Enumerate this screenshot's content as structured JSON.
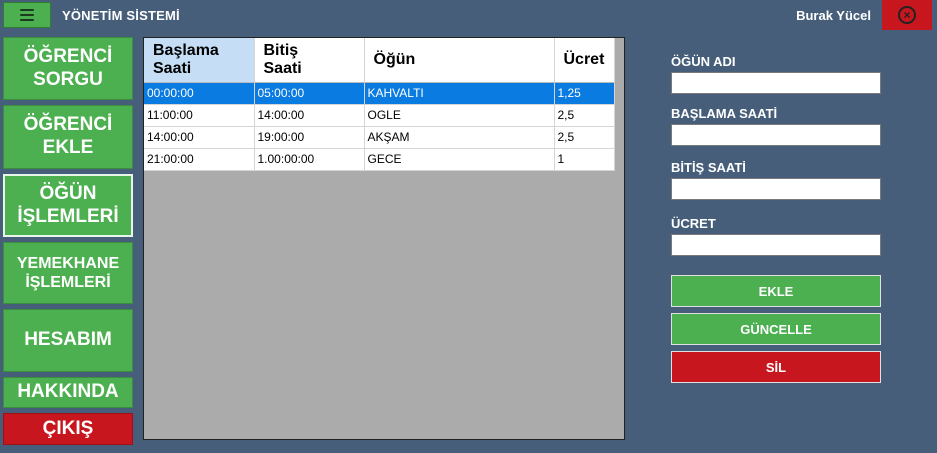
{
  "header": {
    "title": "YÖNETİM SİSTEMİ",
    "user": "Burak Yücel",
    "close_icon": "×"
  },
  "sidebar": {
    "items": [
      {
        "label": "ÖĞRENCİ\nSORGU"
      },
      {
        "label": "ÖĞRENCİ\nEKLE"
      },
      {
        "label": "ÖĞÜN\nİŞLEMLERİ"
      },
      {
        "label": "YEMEKHANE\nİŞLEMLERİ"
      },
      {
        "label": "HESABIM"
      },
      {
        "label": "HAKKINDA"
      },
      {
        "label": "ÇIKIŞ"
      }
    ]
  },
  "table": {
    "columns": [
      "Başlama\nSaati",
      "Bitiş\nSaati",
      "Öğün",
      "Ücret"
    ],
    "rows": [
      [
        "00:00:00",
        "05:00:00",
        "KAHVALTI",
        "1,25"
      ],
      [
        "11:00:00",
        "14:00:00",
        "OGLE",
        "2,5"
      ],
      [
        "14:00:00",
        "19:00:00",
        "AKŞAM",
        "2,5"
      ],
      [
        "21:00:00",
        "1.00:00:00",
        "GECE",
        "1"
      ]
    ]
  },
  "form": {
    "meal_name_label": "ÖĞÜN ADI",
    "meal_name_value": "",
    "start_label": "BAŞLAMA SAATİ",
    "start_value": "",
    "end_label": "BİTİŞ SAATİ",
    "end_value": "",
    "price_label": "ÜCRET",
    "price_value": "",
    "add_label": "EKLE",
    "update_label": "GÜNCELLE",
    "delete_label": "SİL"
  },
  "colors": {
    "accent_green": "#4caf50",
    "danger_red": "#c8161e",
    "background": "#475e7a",
    "selection": "#0a7be0"
  }
}
